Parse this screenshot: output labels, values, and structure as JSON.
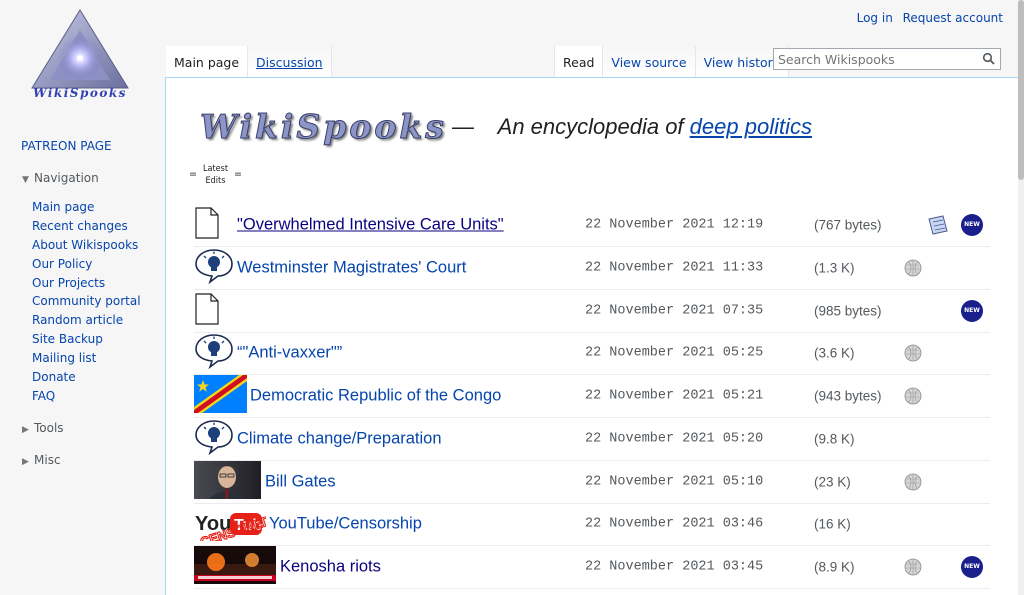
{
  "logo": {
    "text": "WikiSpooks"
  },
  "header": {
    "login": "Log in",
    "request_account": "Request account",
    "tabs_left": [
      "Main page",
      "Discussion"
    ],
    "tabs_right": [
      "Read",
      "View source",
      "View history"
    ],
    "search_placeholder": "Search Wikispooks"
  },
  "sidebar": {
    "patreon": "PATREON PAGE",
    "navigation_label": "Navigation",
    "items": [
      "Main page",
      "Recent changes",
      "About Wikispooks",
      "Our Policy",
      "Our Projects",
      "Community portal",
      "Random article",
      "Site Backup",
      "Mailing list",
      "Donate",
      "FAQ"
    ],
    "tools_label": "Tools",
    "misc_label": "Misc"
  },
  "main": {
    "brand": "WikiSpooks",
    "dash": "—",
    "tagline_prefix": "An encyclopedia of",
    "tagline_link": "deep politics",
    "latest_edits": {
      "eq": "=",
      "line1": "Latest",
      "line2": "Edits"
    },
    "rows": [
      {
        "title": "\"Overwhelmed Intensive Care Units\"",
        "date": "22 November 2021 12:19",
        "size": "(767 bytes)",
        "thumb": "page-icon",
        "wiki": false,
        "note": true,
        "new": true
      },
      {
        "title": "Westminster Magistrates' Court",
        "date": "22 November 2021 11:33",
        "size": "(1.3 K)",
        "thumb": "idea-icon",
        "wiki": true,
        "note": false,
        "new": false
      },
      {
        "title": "",
        "date": "22 November 2021 07:35",
        "size": "(985 bytes)",
        "thumb": "page-icon",
        "wiki": false,
        "note": false,
        "new": true
      },
      {
        "title": "“\"Anti-vaxxer\"”",
        "date": "22 November 2021 05:25",
        "size": "(3.6 K)",
        "thumb": "idea-icon",
        "wiki": true,
        "note": false,
        "new": false
      },
      {
        "title": "Democratic Republic of the Congo",
        "date": "22 November 2021 05:21",
        "size": "(943 bytes)",
        "thumb": "flag-congo",
        "wiki": true,
        "note": false,
        "new": false
      },
      {
        "title": "Climate change/Preparation",
        "date": "22 November 2021 05:20",
        "size": "(9.8 K)",
        "thumb": "idea-icon",
        "wiki": false,
        "note": false,
        "new": false
      },
      {
        "title": "Bill Gates",
        "date": "22 November 2021 05:10",
        "size": "(23 K)",
        "thumb": "photo-person",
        "wiki": true,
        "note": false,
        "new": false
      },
      {
        "title": "YouTube/Censorship",
        "date": "22 November 2021 03:46",
        "size": "(16 K)",
        "thumb": "youtube-logo",
        "wiki": false,
        "note": false,
        "new": false
      },
      {
        "title": "Kenosha riots",
        "date": "22 November 2021 03:45",
        "size": "(8.9 K)",
        "thumb": "photo-riots",
        "wiki": true,
        "note": false,
        "new": true
      }
    ],
    "badge_text": "NEW"
  },
  "colors": {
    "link": "#0645ad",
    "visited": "#0b0080",
    "badge": "#1a1f8c"
  }
}
